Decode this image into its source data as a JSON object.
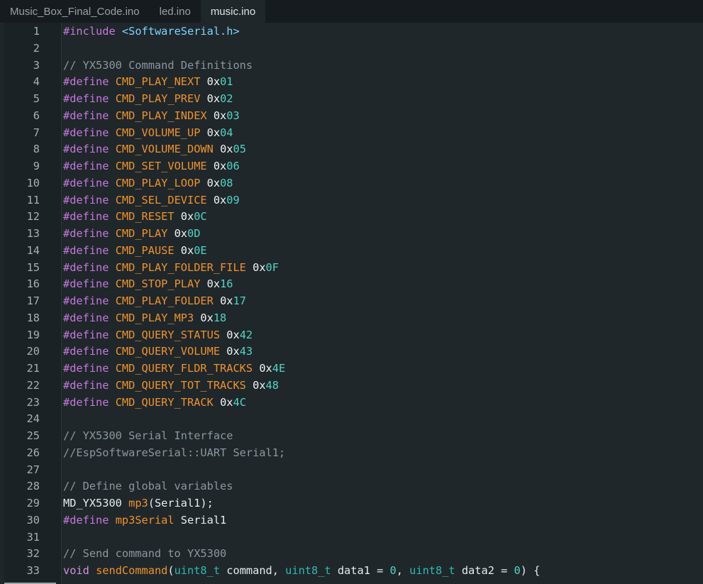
{
  "tabs": [
    {
      "label": "Music_Box_Final_Code.ino",
      "active": false
    },
    {
      "label": "led.ino",
      "active": false
    },
    {
      "label": "music.ino",
      "active": true
    }
  ],
  "colors": {
    "background": "#1f272b",
    "tabbar": "#151b1e",
    "preprocessor": "#c678dd",
    "macro": "#f0922b",
    "hex": "#4fd6c7",
    "comment": "#8a989e",
    "string": "#7fd4ff",
    "type": "#2fb8b0"
  },
  "code_lines": [
    {
      "n": "1",
      "tokens": [
        [
          "pp",
          "#include"
        ],
        [
          "plain",
          " "
        ],
        [
          "str",
          "<SoftwareSerial.h>"
        ]
      ]
    },
    {
      "n": "2",
      "tokens": []
    },
    {
      "n": "3",
      "tokens": [
        [
          "cmt",
          "// YX5300 Command Definitions"
        ]
      ]
    },
    {
      "n": "4",
      "tokens": [
        [
          "pp",
          "#define"
        ],
        [
          "plain",
          " "
        ],
        [
          "mac",
          "CMD_PLAY_NEXT"
        ],
        [
          "plain",
          " "
        ],
        [
          "num",
          "0x"
        ],
        [
          "hex",
          "01"
        ]
      ]
    },
    {
      "n": "5",
      "tokens": [
        [
          "pp",
          "#define"
        ],
        [
          "plain",
          " "
        ],
        [
          "mac",
          "CMD_PLAY_PREV"
        ],
        [
          "plain",
          " "
        ],
        [
          "num",
          "0x"
        ],
        [
          "hex",
          "02"
        ]
      ]
    },
    {
      "n": "6",
      "tokens": [
        [
          "pp",
          "#define"
        ],
        [
          "plain",
          " "
        ],
        [
          "mac",
          "CMD_PLAY_INDEX"
        ],
        [
          "plain",
          " "
        ],
        [
          "num",
          "0x"
        ],
        [
          "hex",
          "03"
        ]
      ]
    },
    {
      "n": "7",
      "tokens": [
        [
          "pp",
          "#define"
        ],
        [
          "plain",
          " "
        ],
        [
          "mac",
          "CMD_VOLUME_UP"
        ],
        [
          "plain",
          " "
        ],
        [
          "num",
          "0x"
        ],
        [
          "hex",
          "04"
        ]
      ]
    },
    {
      "n": "8",
      "tokens": [
        [
          "pp",
          "#define"
        ],
        [
          "plain",
          " "
        ],
        [
          "mac",
          "CMD_VOLUME_DOWN"
        ],
        [
          "plain",
          " "
        ],
        [
          "num",
          "0x"
        ],
        [
          "hex",
          "05"
        ]
      ]
    },
    {
      "n": "9",
      "tokens": [
        [
          "pp",
          "#define"
        ],
        [
          "plain",
          " "
        ],
        [
          "mac",
          "CMD_SET_VOLUME"
        ],
        [
          "plain",
          " "
        ],
        [
          "num",
          "0x"
        ],
        [
          "hex",
          "06"
        ]
      ]
    },
    {
      "n": "10",
      "tokens": [
        [
          "pp",
          "#define"
        ],
        [
          "plain",
          " "
        ],
        [
          "mac",
          "CMD_PLAY_LOOP"
        ],
        [
          "plain",
          " "
        ],
        [
          "num",
          "0x"
        ],
        [
          "hex",
          "08"
        ]
      ]
    },
    {
      "n": "11",
      "tokens": [
        [
          "pp",
          "#define"
        ],
        [
          "plain",
          " "
        ],
        [
          "mac",
          "CMD_SEL_DEVICE"
        ],
        [
          "plain",
          " "
        ],
        [
          "num",
          "0x"
        ],
        [
          "hex",
          "09"
        ]
      ]
    },
    {
      "n": "12",
      "tokens": [
        [
          "pp",
          "#define"
        ],
        [
          "plain",
          " "
        ],
        [
          "mac",
          "CMD_RESET"
        ],
        [
          "plain",
          " "
        ],
        [
          "num",
          "0x"
        ],
        [
          "hex",
          "0C"
        ]
      ]
    },
    {
      "n": "13",
      "tokens": [
        [
          "pp",
          "#define"
        ],
        [
          "plain",
          " "
        ],
        [
          "mac",
          "CMD_PLAY"
        ],
        [
          "plain",
          " "
        ],
        [
          "num",
          "0x"
        ],
        [
          "hex",
          "0D"
        ]
      ]
    },
    {
      "n": "14",
      "tokens": [
        [
          "pp",
          "#define"
        ],
        [
          "plain",
          " "
        ],
        [
          "mac",
          "CMD_PAUSE"
        ],
        [
          "plain",
          " "
        ],
        [
          "num",
          "0x"
        ],
        [
          "hex",
          "0E"
        ]
      ]
    },
    {
      "n": "15",
      "tokens": [
        [
          "pp",
          "#define"
        ],
        [
          "plain",
          " "
        ],
        [
          "mac",
          "CMD_PLAY_FOLDER_FILE"
        ],
        [
          "plain",
          " "
        ],
        [
          "num",
          "0x"
        ],
        [
          "hex",
          "0F"
        ]
      ]
    },
    {
      "n": "16",
      "tokens": [
        [
          "pp",
          "#define"
        ],
        [
          "plain",
          " "
        ],
        [
          "mac",
          "CMD_STOP_PLAY"
        ],
        [
          "plain",
          " "
        ],
        [
          "num",
          "0x"
        ],
        [
          "hex",
          "16"
        ]
      ]
    },
    {
      "n": "17",
      "tokens": [
        [
          "pp",
          "#define"
        ],
        [
          "plain",
          " "
        ],
        [
          "mac",
          "CMD_PLAY_FOLDER"
        ],
        [
          "plain",
          " "
        ],
        [
          "num",
          "0x"
        ],
        [
          "hex",
          "17"
        ]
      ]
    },
    {
      "n": "18",
      "tokens": [
        [
          "pp",
          "#define"
        ],
        [
          "plain",
          " "
        ],
        [
          "mac",
          "CMD_PLAY_MP3"
        ],
        [
          "plain",
          " "
        ],
        [
          "num",
          "0x"
        ],
        [
          "hex",
          "18"
        ]
      ]
    },
    {
      "n": "19",
      "tokens": [
        [
          "pp",
          "#define"
        ],
        [
          "plain",
          " "
        ],
        [
          "mac",
          "CMD_QUERY_STATUS"
        ],
        [
          "plain",
          " "
        ],
        [
          "num",
          "0x"
        ],
        [
          "hex",
          "42"
        ]
      ]
    },
    {
      "n": "20",
      "tokens": [
        [
          "pp",
          "#define"
        ],
        [
          "plain",
          " "
        ],
        [
          "mac",
          "CMD_QUERY_VOLUME"
        ],
        [
          "plain",
          " "
        ],
        [
          "num",
          "0x"
        ],
        [
          "hex",
          "43"
        ]
      ]
    },
    {
      "n": "21",
      "tokens": [
        [
          "pp",
          "#define"
        ],
        [
          "plain",
          " "
        ],
        [
          "mac",
          "CMD_QUERY_FLDR_TRACKS"
        ],
        [
          "plain",
          " "
        ],
        [
          "num",
          "0x"
        ],
        [
          "hex",
          "4E"
        ]
      ]
    },
    {
      "n": "22",
      "tokens": [
        [
          "pp",
          "#define"
        ],
        [
          "plain",
          " "
        ],
        [
          "mac",
          "CMD_QUERY_TOT_TRACKS"
        ],
        [
          "plain",
          " "
        ],
        [
          "num",
          "0x"
        ],
        [
          "hex",
          "48"
        ]
      ]
    },
    {
      "n": "23",
      "tokens": [
        [
          "pp",
          "#define"
        ],
        [
          "plain",
          " "
        ],
        [
          "mac",
          "CMD_QUERY_TRACK"
        ],
        [
          "plain",
          " "
        ],
        [
          "num",
          "0x"
        ],
        [
          "hex",
          "4C"
        ]
      ]
    },
    {
      "n": "24",
      "tokens": []
    },
    {
      "n": "25",
      "tokens": [
        [
          "cmt",
          "// YX5300 Serial Interface"
        ]
      ]
    },
    {
      "n": "26",
      "tokens": [
        [
          "cmt",
          "//EspSoftwareSerial::UART Serial1;"
        ]
      ]
    },
    {
      "n": "27",
      "tokens": []
    },
    {
      "n": "28",
      "tokens": [
        [
          "cmt",
          "// Define global variables"
        ]
      ]
    },
    {
      "n": "29",
      "tokens": [
        [
          "plain",
          "MD_YX5300 "
        ],
        [
          "fn",
          "mp3"
        ],
        [
          "plain",
          "(Serial1);"
        ]
      ]
    },
    {
      "n": "30",
      "tokens": [
        [
          "pp",
          "#define"
        ],
        [
          "plain",
          " "
        ],
        [
          "mac",
          "mp3Serial"
        ],
        [
          "plain",
          " Serial1"
        ]
      ]
    },
    {
      "n": "31",
      "tokens": []
    },
    {
      "n": "32",
      "tokens": [
        [
          "cmt",
          "// Send command to YX5300"
        ]
      ]
    },
    {
      "n": "33",
      "tokens": [
        [
          "kw",
          "void"
        ],
        [
          "plain",
          " "
        ],
        [
          "fn",
          "sendCommand"
        ],
        [
          "plain",
          "("
        ],
        [
          "ty",
          "uint8_t"
        ],
        [
          "plain",
          " command, "
        ],
        [
          "ty",
          "uint8_t"
        ],
        [
          "plain",
          " data1 = "
        ],
        [
          "lit",
          "0"
        ],
        [
          "plain",
          ", "
        ],
        [
          "ty",
          "uint8_t"
        ],
        [
          "plain",
          " data2 = "
        ],
        [
          "lit",
          "0"
        ],
        [
          "plain",
          ") {"
        ]
      ]
    }
  ]
}
